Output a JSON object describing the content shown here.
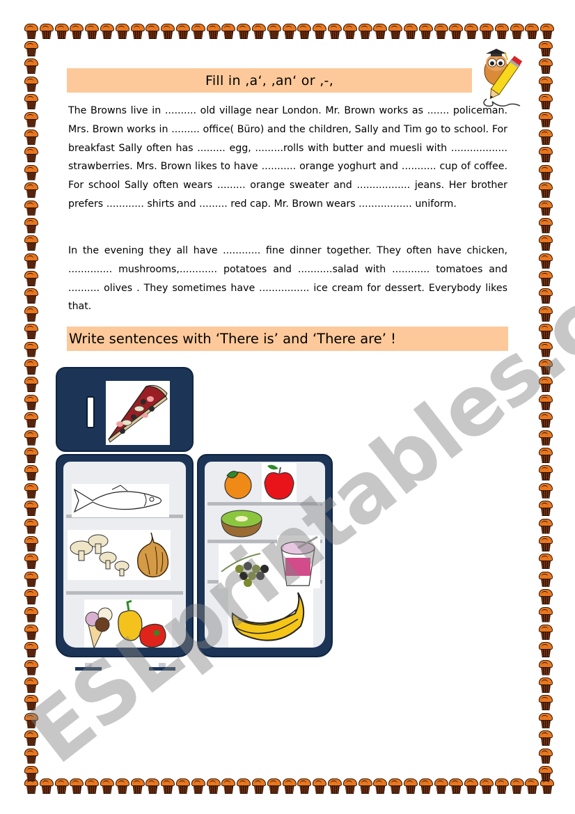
{
  "worksheet": {
    "title": "Fill in ‚a‘, ‚an‘ or    ‚-‚",
    "paragraph1": "The Browns live in .......... old village near London. Mr. Brown works as ....... policeman.  Mrs. Brown works in ......... office( Büro) and the children, Sally and Tim go to school. For breakfast Sally often has ......... egg, .........rolls with butter and muesli with .................. strawberries. Mrs. Brown likes to have ........... orange yoghurt and ........... cup of coffee. For school Sally often wears ......... orange sweater and ................. jeans. Her brother prefers ............ shirts and ......... red cap. Mr. Brown wears ................. uniform.",
    "paragraph2": "In the evening they all have ............ fine dinner together. They often have chicken, .............. mushrooms,............ potatoes  and ...........salad with ............ tomatoes and .......... olives . They sometimes have ................ ice cream for dessert. Everybody likes that.",
    "section2_title": "Write sentences with ‘There is’ and ‘There are’ !",
    "watermark": "ESLprintables.com"
  },
  "colors": {
    "banner": "#fdc99a",
    "fridge": "#1c3557",
    "muffin_top": "#e9771f",
    "muffin_cup": "#6e2d10"
  },
  "decorations": {
    "owl_icon": "owl-with-pencil-icon",
    "border_icon": "muffin-icon"
  },
  "fridge": {
    "freezer_items": [
      "pizza"
    ],
    "left_door_items": [
      "fish",
      "mushrooms",
      "onion",
      "ice cream",
      "yellow pepper",
      "red pepper"
    ],
    "right_door_items": [
      "orange",
      "apple",
      "kiwi",
      "olives",
      "yoghurt",
      "bananas"
    ]
  }
}
